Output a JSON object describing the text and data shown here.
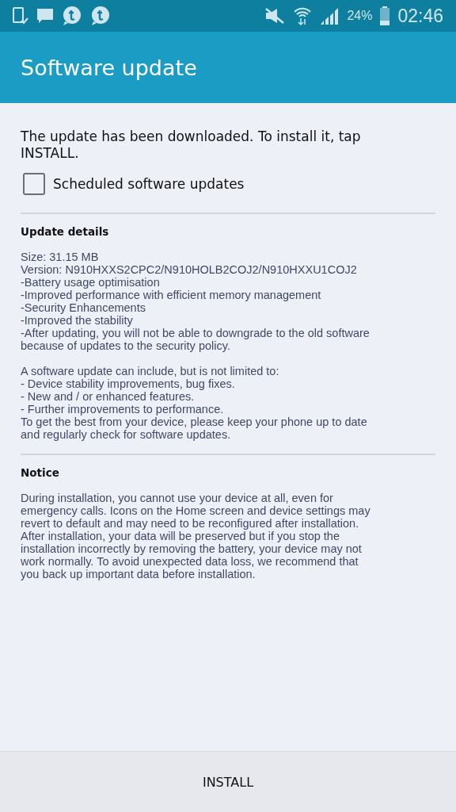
{
  "status_bar": {
    "battery": "24%",
    "time": "02:46"
  },
  "header": {
    "title": "Software update"
  },
  "message": [
    "The update has been downloaded. To install it, tap",
    "INSTALL."
  ],
  "scheduled": {
    "label": "Scheduled software updates",
    "checked": false
  },
  "sections": [
    {
      "heading": "Update details",
      "paragraphs": [
        [
          "Size: 31.15 MB",
          "Version: N910HXXS2CPC2/N910HOLB2COJ2/N910HXXU1COJ2",
          "-Battery usage optimisation",
          "-Improved performance with efficient memory management",
          "-Security Enhancements",
          "-Improved the stability",
          "-After updating, you will not be able to downgrade to the old software",
          "because of updates to the security policy."
        ],
        [
          "A software update can include, but is not limited to:",
          " - Device stability improvements, bug fixes.",
          " - New and / or enhanced features.",
          " - Further improvements to performance.",
          "To get the best from your device, please keep your phone up to date",
          "and regularly check for software updates."
        ]
      ]
    },
    {
      "heading": "Notice",
      "paragraphs": [
        [
          "During installation, you cannot use your device at all, even for",
          "emergency calls. Icons on the Home screen and device settings may",
          "revert to default and may need to be reconfigured after installation.",
          "After installation, your data will be preserved but if you stop the",
          "installation incorrectly by removing the battery, your device may not",
          "work normally. To avoid unexpected data loss, we recommend that",
          "you back up important data before installation."
        ]
      ]
    }
  ],
  "install_button": "INSTALL"
}
